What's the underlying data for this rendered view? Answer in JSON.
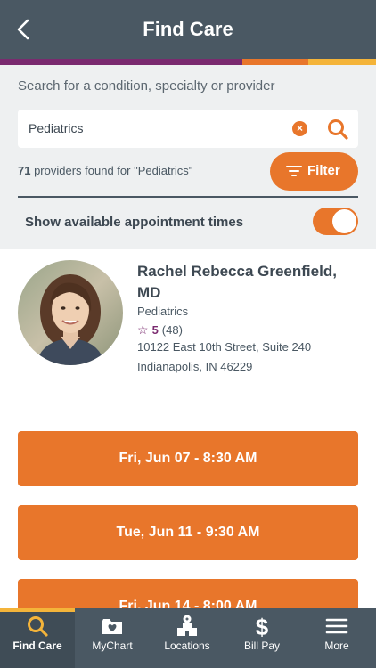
{
  "header": {
    "title": "Find Care"
  },
  "colors": {
    "header": "#4a5863",
    "accent": "#e8762b",
    "purple": "#7a2a6f",
    "yellow": "#f4b43a"
  },
  "search": {
    "prompt": "Search for a condition, specialty or provider",
    "value": "Pediatrics",
    "result_count": "71",
    "result_text": " providers found for \"Pediatrics\"",
    "filter_label": "Filter",
    "toggle_label": "Show available appointment times",
    "toggle_on": true
  },
  "provider": {
    "name": "Rachel Rebecca Greenfield, MD",
    "specialty": "Pediatrics",
    "rating": "5",
    "review_count": "(48)",
    "address_line1": "10122 East 10th Street, Suite 240",
    "address_line2": "Indianapolis, IN 46229"
  },
  "appointments": [
    "Fri, Jun 07 - 8:30 AM",
    "Tue, Jun 11 - 9:30 AM",
    "Fri, Jun 14 - 8:00 AM"
  ],
  "tabs": [
    {
      "label": "Find Care",
      "icon": "search-icon"
    },
    {
      "label": "MyChart",
      "icon": "folder-heart-icon"
    },
    {
      "label": "Locations",
      "icon": "hospital-icon"
    },
    {
      "label": "Bill Pay",
      "icon": "dollar-icon"
    },
    {
      "label": "More",
      "icon": "menu-icon"
    }
  ]
}
